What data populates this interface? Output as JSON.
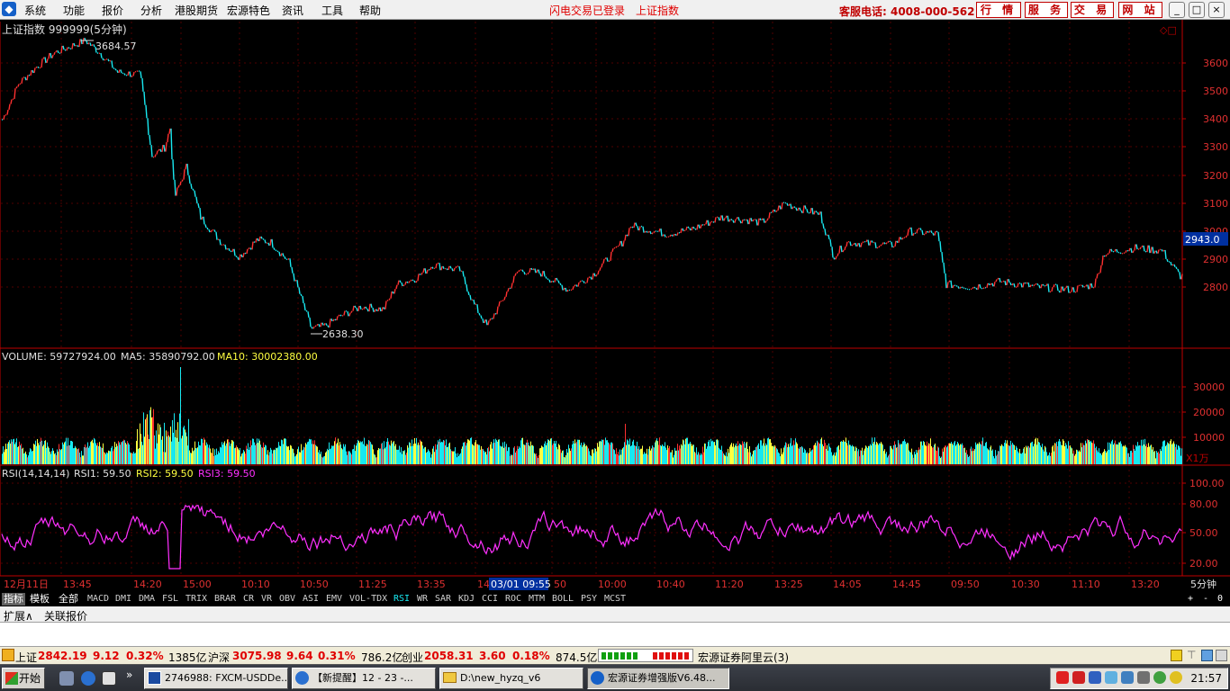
{
  "menubar": {
    "items": [
      "系统",
      "功能",
      "报价",
      "分析",
      "港股期货",
      "宏源特色",
      "资讯",
      "工具",
      "帮助"
    ],
    "notice1": "闪电交易已登录",
    "notice2": "上证指数",
    "hotline": "客服电话: 4008-000-562",
    "buttons": [
      "行 情",
      "服 务",
      "交 易",
      "网 站"
    ],
    "window_controls": [
      "_",
      "□",
      "×"
    ]
  },
  "price_panel": {
    "title": "上证指数 999999(5分钟)",
    "high_label": "3684.57",
    "low_label": "2638.30",
    "current_price": "2943.0",
    "y_ticks": [
      "3600",
      "3500",
      "3400",
      "3300",
      "3200",
      "3100",
      "3000",
      "2900",
      "2800"
    ]
  },
  "volume_panel": {
    "label": "VOLUME: 59727924.00",
    "ma5": "MA5: 35890792.00",
    "ma10": "MA10: 30002380.00",
    "y_ticks": [
      "30000",
      "20000",
      "10000"
    ],
    "unit": "X1万"
  },
  "rsi_panel": {
    "label": "RSI(14,14,14)",
    "rsi1": "RSI1: 59.50",
    "rsi2": "RSI2: 59.50",
    "rsi3": "RSI3: 59.50",
    "y_ticks": [
      "100.00",
      "80.00",
      "50.00",
      "20.00"
    ]
  },
  "time_axis": {
    "labels": [
      "12月11日",
      "13:45",
      "14:20",
      "15:00",
      "10:10",
      "10:50",
      "11:25",
      "13:35",
      "14",
      "50",
      "10:00",
      "10:40",
      "11:20",
      "13:25",
      "14:05",
      "14:45",
      "09:50",
      "10:30",
      "11:10",
      "13:20"
    ],
    "cursor": "03/01 09:55",
    "period": "5分钟"
  },
  "indicator_tabs": [
    "指标",
    "模板",
    "全部",
    "MACD",
    "DMI",
    "DMA",
    "FSL",
    "TRIX",
    "BRAR",
    "CR",
    "VR",
    "OBV",
    "ASI",
    "EMV",
    "VOL-TDX",
    "RSI",
    "WR",
    "SAR",
    "KDJ",
    "CCI",
    "ROC",
    "MTM",
    "BOLL",
    "PSY",
    "MCST"
  ],
  "active_tab": "RSI",
  "zoom_controls": [
    "+",
    "-",
    "0"
  ],
  "ext_tabs": [
    "扩展∧",
    "关联报价"
  ],
  "status": {
    "sh_label": "上证",
    "sh_value": "2842.19",
    "sh_change": "9.12",
    "sh_pct": "0.32%",
    "sh_amount": "1385亿",
    "hs_label": "沪深",
    "hs_value": "3075.98",
    "hs_change": "9.64",
    "hs_pct": "0.31%",
    "hs_amount": "786.2亿",
    "cy_label": "创业",
    "cy_value": "2058.31",
    "cy_change": "3.60",
    "cy_pct": "0.18%",
    "cy_amount": "874.5亿",
    "broker": "宏源证券阿里云(3)"
  },
  "taskbar": {
    "start": "开始",
    "items": [
      "2746988: FXCM-USDDe...",
      "【新提醒】12 - 23 -...",
      "D:\\new_hyzq_v6",
      "宏源证券增强版V6.48..."
    ],
    "clock": "21:57"
  },
  "colors": {
    "up": "#ff3030",
    "down": "#18e8f0",
    "volume": "#ffff40",
    "rsi": "#ff30ff",
    "axis": "#c00000",
    "grid": "#500000"
  }
}
